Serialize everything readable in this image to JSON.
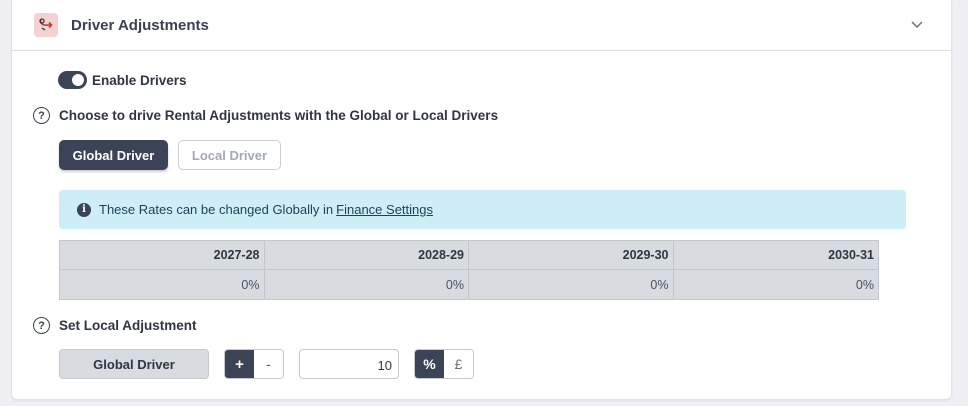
{
  "header": {
    "title": "Driver Adjustments",
    "icon": "driver-route-icon",
    "accent": "#f5d2d2"
  },
  "toggle": {
    "label": "Enable Drivers",
    "enabled": true
  },
  "driver_choice": {
    "question": "Choose to drive Rental Adjustments with the Global or Local Drivers",
    "options": [
      "Global Driver",
      "Local Driver"
    ],
    "selected": "Global Driver"
  },
  "info": {
    "text": "These Rates can be changed Globally in",
    "link": "Finance Settings"
  },
  "rates_table": {
    "headers": [
      "2027-28",
      "2028-29",
      "2029-30",
      "2030-31"
    ],
    "values": [
      "0%",
      "0%",
      "0%",
      "0%"
    ]
  },
  "local_adjustment": {
    "label": "Set Local Adjustment",
    "driver_label": "Global Driver",
    "plus": "+",
    "minus": "-",
    "value": "10",
    "unit_percent": "%",
    "unit_pound": "£"
  },
  "colors": {
    "dark": "#3b4457",
    "info_bg": "#cdeef7",
    "table_bg": "#d8dbe0"
  }
}
